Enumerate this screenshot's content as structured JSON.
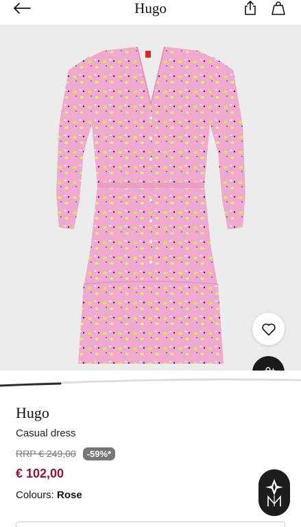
{
  "header": {
    "title": "Hugo",
    "back_icon": "arrow-left-icon",
    "share_icon": "share-icon",
    "bag_icon": "shopping-bag-icon"
  },
  "gallery": {
    "image": "pink floral long-sleeve dress",
    "favorite_icon": "heart-icon",
    "add_to_bag_icon": "bag-plus-icon",
    "slide_progress": 0.2
  },
  "product": {
    "brand": "Hugo",
    "name": "Casual dress",
    "rrp": "RRP € 249,00",
    "discount": "-59%*",
    "price": "€ 102,00",
    "colours_label": "Colours:",
    "colour_value": "Rose"
  },
  "colors": {
    "price": "#8c1530",
    "dress_pink": "#f2a9cf",
    "badge_bg": "#1c1c1c"
  }
}
